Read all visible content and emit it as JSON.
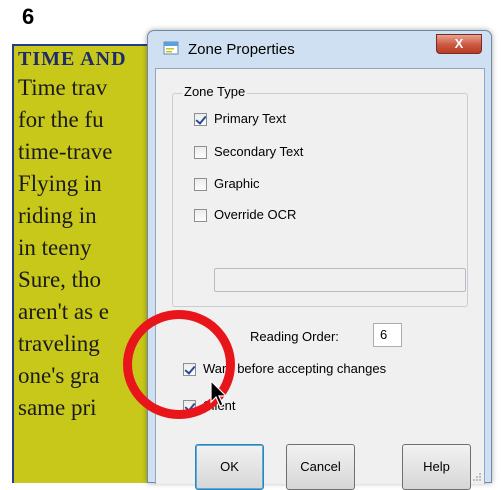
{
  "document": {
    "page_number": "6",
    "lines": [
      "TIME AND",
      "Time trav",
      "for the fu",
      "time-trave",
      "Flying in",
      "riding in",
      "in teeny",
      "Sure, tho",
      "aren't as e",
      "traveling",
      "one's gra",
      "same pri"
    ]
  },
  "dialog": {
    "title": "Zone Properties",
    "close_glyph": "X",
    "zone_type": {
      "legend": "Zone Type",
      "options": [
        {
          "label": "Primary Text",
          "checked": true
        },
        {
          "label": "Secondary Text",
          "checked": false
        },
        {
          "label": "Graphic",
          "checked": false
        },
        {
          "label": "Override OCR",
          "checked": false
        }
      ],
      "override_field_value": ""
    },
    "reading_order": {
      "label": "Reading Order:",
      "value": "6"
    },
    "warn": {
      "label": "Warn before accepting changes",
      "checked": true
    },
    "silent": {
      "label": "Silent",
      "checked": true
    },
    "buttons": {
      "ok": "OK",
      "cancel": "Cancel",
      "help": "Help"
    }
  },
  "colors": {
    "zone_highlight": "#c8c81a",
    "annotation_circle": "#e8161b",
    "window_frame": "#cfe0f2"
  }
}
